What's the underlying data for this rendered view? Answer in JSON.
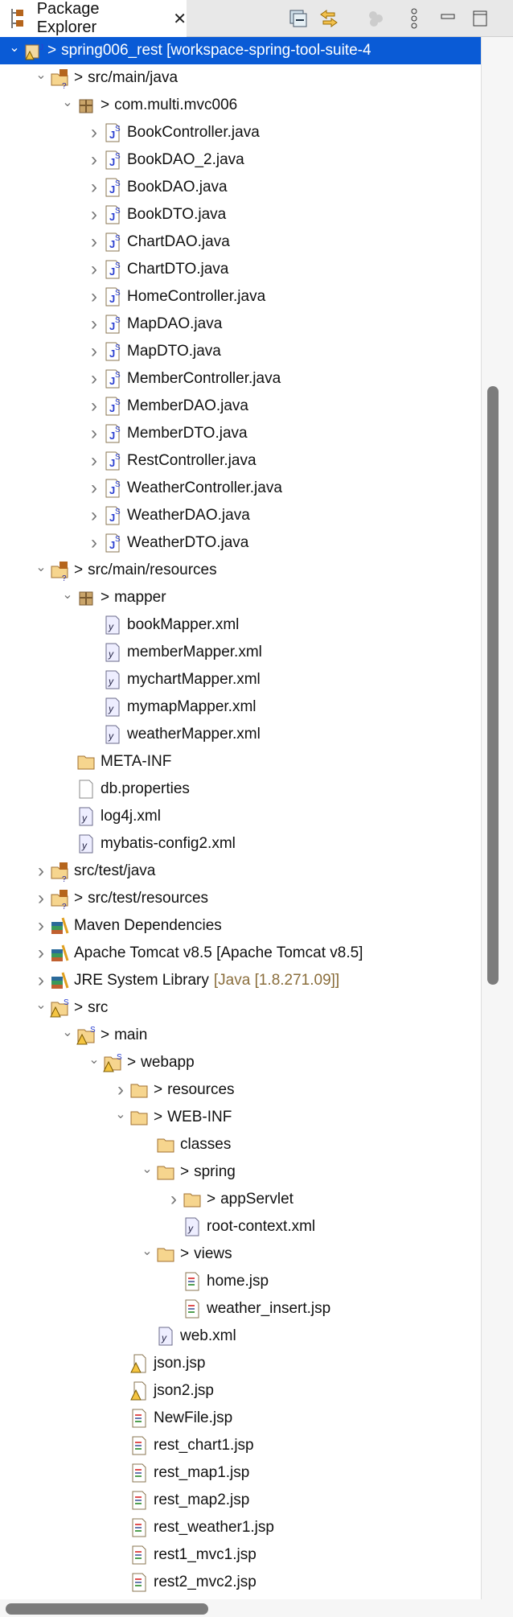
{
  "header": {
    "title": "Package Explorer"
  },
  "tree": [
    {
      "d": 0,
      "exp": true,
      "icon": "project-icon",
      "pfx": true,
      "text": "spring006_rest [workspace-spring-tool-suite-4",
      "sel": true
    },
    {
      "d": 1,
      "exp": true,
      "icon": "source-folder-icon",
      "pfx": true,
      "text": "src/main/java"
    },
    {
      "d": 2,
      "exp": true,
      "icon": "package-icon",
      "pfx": true,
      "text": "com.multi.mvc006"
    },
    {
      "d": 3,
      "exp": false,
      "icon": "java-file-icon",
      "text": "BookController.java"
    },
    {
      "d": 3,
      "exp": false,
      "icon": "java-file-icon",
      "text": "BookDAO_2.java"
    },
    {
      "d": 3,
      "exp": false,
      "icon": "java-file-icon",
      "text": "BookDAO.java"
    },
    {
      "d": 3,
      "exp": false,
      "icon": "java-file-icon",
      "text": "BookDTO.java"
    },
    {
      "d": 3,
      "exp": false,
      "icon": "java-file-icon",
      "text": "ChartDAO.java"
    },
    {
      "d": 3,
      "exp": false,
      "icon": "java-file-icon",
      "text": "ChartDTO.java"
    },
    {
      "d": 3,
      "exp": false,
      "icon": "java-file-icon",
      "text": "HomeController.java"
    },
    {
      "d": 3,
      "exp": false,
      "icon": "java-file-icon",
      "text": "MapDAO.java"
    },
    {
      "d": 3,
      "exp": false,
      "icon": "java-file-icon",
      "text": "MapDTO.java"
    },
    {
      "d": 3,
      "exp": false,
      "icon": "java-file-icon",
      "text": "MemberController.java"
    },
    {
      "d": 3,
      "exp": false,
      "icon": "java-file-icon",
      "text": "MemberDAO.java"
    },
    {
      "d": 3,
      "exp": false,
      "icon": "java-file-icon",
      "text": "MemberDTO.java"
    },
    {
      "d": 3,
      "exp": false,
      "icon": "java-file-icon",
      "text": "RestController.java"
    },
    {
      "d": 3,
      "exp": false,
      "icon": "java-file-icon",
      "text": "WeatherController.java"
    },
    {
      "d": 3,
      "exp": false,
      "icon": "java-file-icon",
      "text": "WeatherDAO.java"
    },
    {
      "d": 3,
      "exp": false,
      "icon": "java-file-icon",
      "text": "WeatherDTO.java"
    },
    {
      "d": 1,
      "exp": true,
      "icon": "source-folder-icon",
      "pfx": true,
      "text": "src/main/resources"
    },
    {
      "d": 2,
      "exp": true,
      "icon": "package-icon",
      "pfx": true,
      "text": "mapper"
    },
    {
      "d": 3,
      "icon": "xml-file-icon",
      "text": "bookMapper.xml"
    },
    {
      "d": 3,
      "icon": "xml-file-icon",
      "text": "memberMapper.xml"
    },
    {
      "d": 3,
      "icon": "xml-file-icon",
      "text": "mychartMapper.xml"
    },
    {
      "d": 3,
      "icon": "xml-file-icon",
      "text": "mymapMapper.xml"
    },
    {
      "d": 3,
      "icon": "xml-file-icon",
      "text": "weatherMapper.xml"
    },
    {
      "d": 2,
      "icon": "folder-icon",
      "text": "META-INF"
    },
    {
      "d": 2,
      "icon": "file-icon",
      "text": "db.properties"
    },
    {
      "d": 2,
      "icon": "xml-file-icon",
      "text": "log4j.xml"
    },
    {
      "d": 2,
      "icon": "xml-file-icon",
      "text": "mybatis-config2.xml"
    },
    {
      "d": 1,
      "exp": false,
      "icon": "source-folder-icon",
      "text": "src/test/java"
    },
    {
      "d": 1,
      "exp": false,
      "icon": "source-folder-icon",
      "pfx": true,
      "text": "src/test/resources"
    },
    {
      "d": 1,
      "exp": false,
      "icon": "library-icon",
      "text": "Maven Dependencies"
    },
    {
      "d": 1,
      "exp": false,
      "icon": "library-icon",
      "text": "Apache Tomcat v8.5 [Apache Tomcat v8.5]"
    },
    {
      "d": 1,
      "exp": false,
      "icon": "library-icon",
      "text": "JRE System Library",
      "extra": "[Java [1.8.271.09]]"
    },
    {
      "d": 1,
      "exp": true,
      "icon": "warning-folder-icon",
      "pfx": true,
      "text": "src"
    },
    {
      "d": 2,
      "exp": true,
      "icon": "warning-folder-icon",
      "pfx": true,
      "text": "main"
    },
    {
      "d": 3,
      "exp": true,
      "icon": "warning-folder-icon",
      "pfx": true,
      "text": "webapp"
    },
    {
      "d": 4,
      "exp": false,
      "icon": "folder-icon",
      "pfx": true,
      "text": "resources"
    },
    {
      "d": 4,
      "exp": true,
      "icon": "folder-icon",
      "pfx": true,
      "text": "WEB-INF"
    },
    {
      "d": 5,
      "icon": "folder-icon",
      "text": "classes"
    },
    {
      "d": 5,
      "exp": true,
      "icon": "folder-icon",
      "pfx": true,
      "text": "spring"
    },
    {
      "d": 6,
      "exp": false,
      "icon": "folder-icon",
      "pfx": true,
      "text": "appServlet"
    },
    {
      "d": 6,
      "icon": "xml-file-icon",
      "text": "root-context.xml"
    },
    {
      "d": 5,
      "exp": true,
      "icon": "folder-icon",
      "pfx": true,
      "text": "views"
    },
    {
      "d": 6,
      "icon": "jsp-file-icon",
      "text": "home.jsp"
    },
    {
      "d": 6,
      "icon": "jsp-file-icon",
      "text": "weather_insert.jsp"
    },
    {
      "d": 5,
      "icon": "xml-file-icon",
      "text": "web.xml"
    },
    {
      "d": 4,
      "icon": "warning-file-icon",
      "text": "json.jsp"
    },
    {
      "d": 4,
      "icon": "warning-file-icon",
      "text": "json2.jsp"
    },
    {
      "d": 4,
      "icon": "jsp-file-icon",
      "text": "NewFile.jsp"
    },
    {
      "d": 4,
      "icon": "jsp-file-icon",
      "text": "rest_chart1.jsp"
    },
    {
      "d": 4,
      "icon": "jsp-file-icon",
      "text": "rest_map1.jsp"
    },
    {
      "d": 4,
      "icon": "jsp-file-icon",
      "text": "rest_map2.jsp"
    },
    {
      "d": 4,
      "icon": "jsp-file-icon",
      "text": "rest_weather1.jsp"
    },
    {
      "d": 4,
      "icon": "jsp-file-icon",
      "text": "rest1_mvc1.jsp"
    },
    {
      "d": 4,
      "icon": "jsp-file-icon",
      "text": "rest2_mvc2.jsp"
    }
  ]
}
